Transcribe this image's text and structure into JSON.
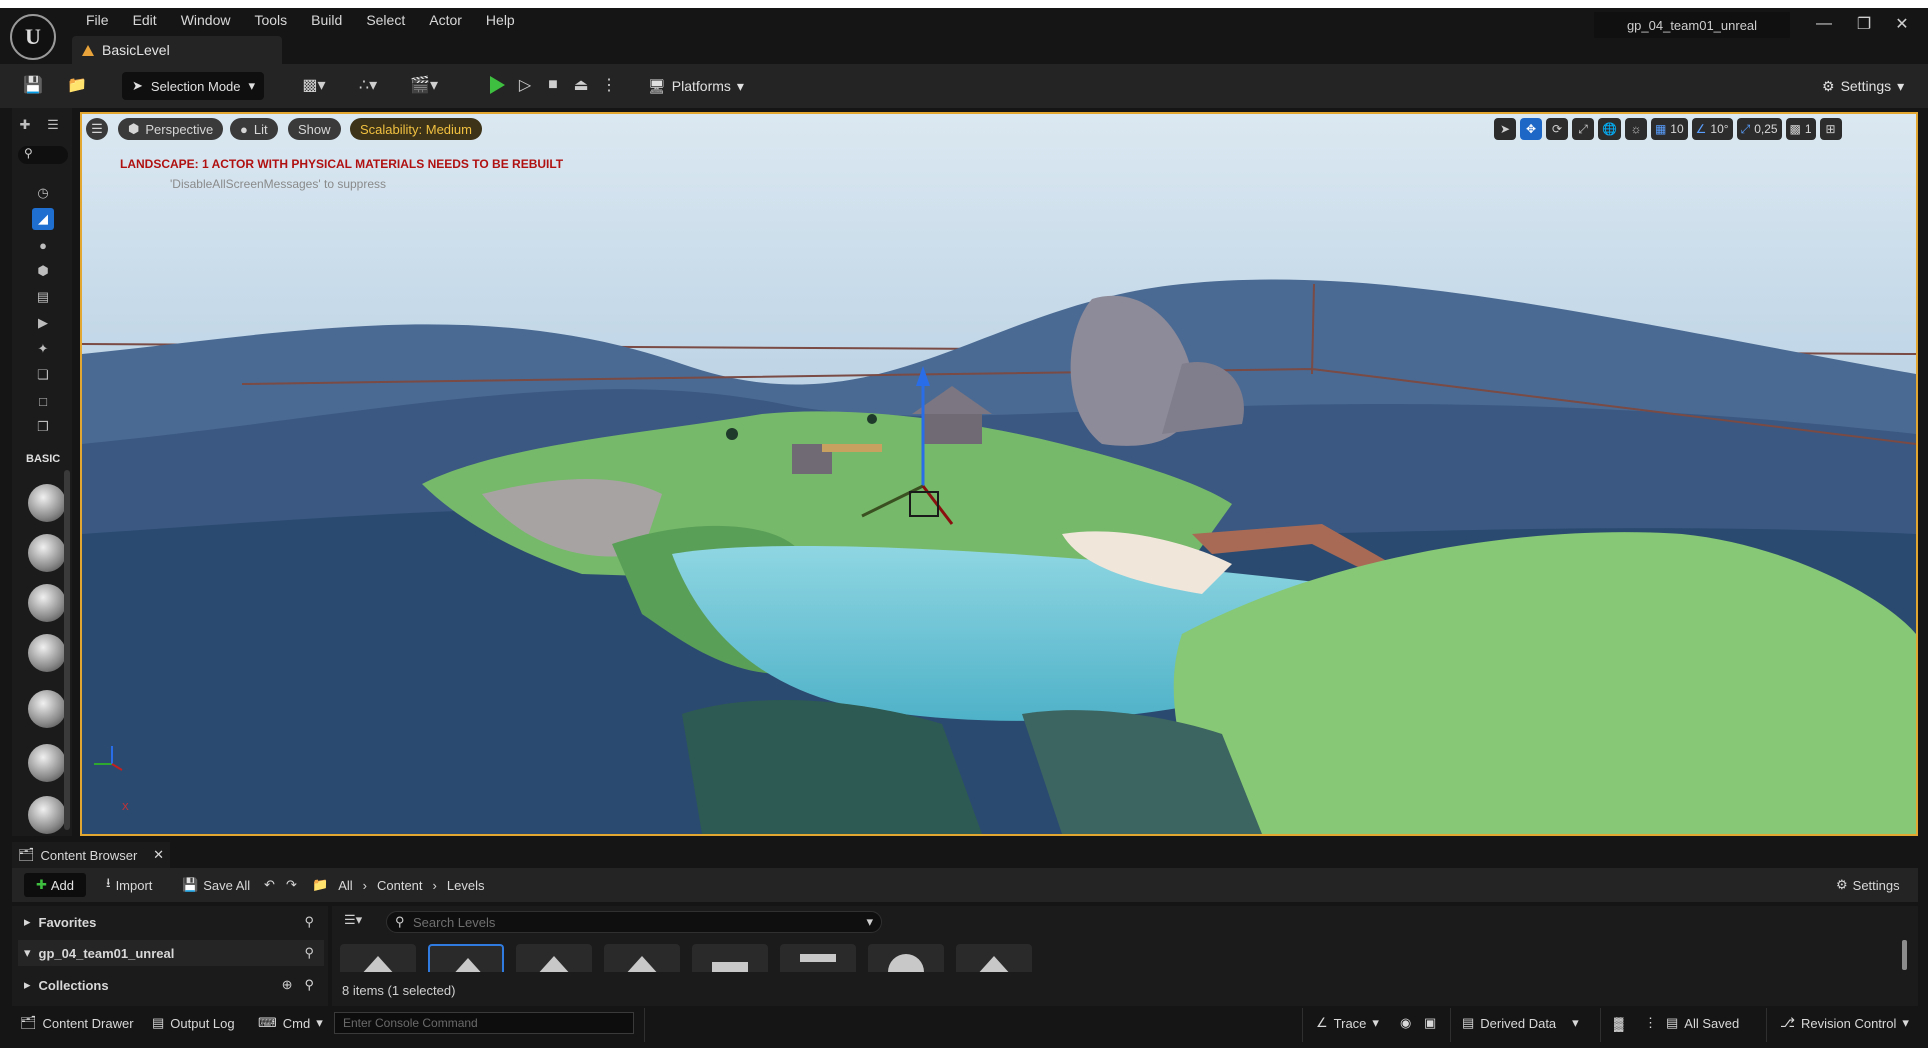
{
  "app": {
    "logo_text": "U",
    "menu": [
      "File",
      "Edit",
      "Window",
      "Tools",
      "Build",
      "Select",
      "Actor",
      "Help"
    ],
    "project_title": "gp_04_team01_unreal",
    "level_tab": "BasicLevel"
  },
  "toolbar": {
    "selection_mode": "Selection Mode",
    "platforms": "Platforms",
    "settings": "Settings"
  },
  "left_panel": {
    "basic_label": "BASIC"
  },
  "viewport": {
    "perspective": "Perspective",
    "lit": "Lit",
    "show": "Show",
    "scalability": "Scalability: Medium",
    "warning": "LANDSCAPE: 1 ACTOR WITH PHYSICAL MATERIALS NEEDS TO BE REBUILT",
    "suppress_hint": "'DisableAllScreenMessages' to suppress",
    "grid_snap": "10",
    "rotation_snap": "10°",
    "scale_snap": "0,25",
    "camera_speed": "1",
    "axis_x": "X",
    "colors": {
      "selection_border": "#e1a730",
      "warning_text": "#b01010",
      "scalability_text": "#f1c040"
    }
  },
  "content_browser": {
    "tab": "Content Browser",
    "add": "Add",
    "import": "Import",
    "save_all": "Save All",
    "breadcrumbs": [
      "All",
      "Content",
      "Levels"
    ],
    "settings": "Settings",
    "tree": {
      "favorites": "Favorites",
      "project": "gp_04_team01_unreal",
      "collections": "Collections"
    },
    "search_placeholder": "Search Levels",
    "items_count": "8 items (1 selected)"
  },
  "status_bar": {
    "content_drawer": "Content Drawer",
    "output_log": "Output Log",
    "cmd": "Cmd",
    "console_placeholder": "Enter Console Command",
    "trace": "Trace",
    "derived_data": "Derived Data",
    "all_saved": "All Saved",
    "revision_control": "Revision Control"
  }
}
